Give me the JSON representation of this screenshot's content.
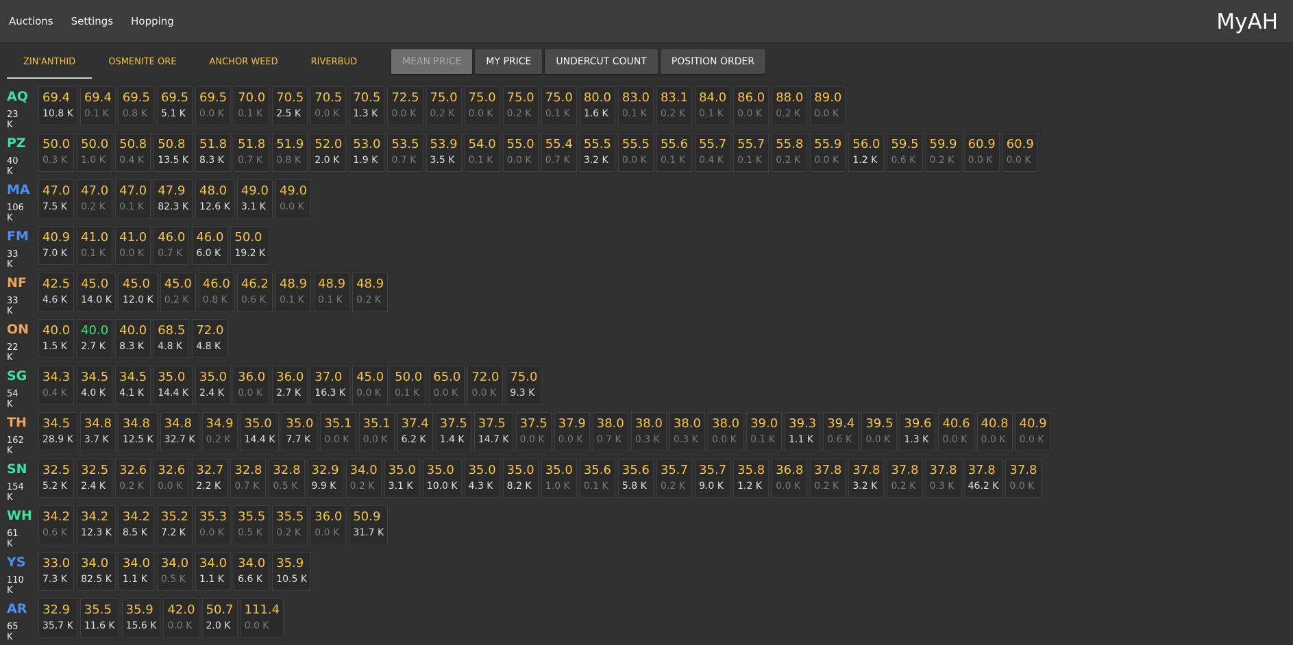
{
  "app": {
    "title": "MyAH",
    "menu": [
      "Auctions",
      "Settings",
      "Hopping"
    ]
  },
  "tabs": [
    {
      "label": "ZIN'ANTHID",
      "active": true
    },
    {
      "label": "OSMENITE ORE",
      "active": false
    },
    {
      "label": "ANCHOR WEED",
      "active": false
    },
    {
      "label": "RIVERBUD",
      "active": false
    }
  ],
  "mode_buttons": [
    {
      "label": "MEAN PRICE",
      "active": true
    },
    {
      "label": "MY PRICE",
      "active": false
    },
    {
      "label": "UNDERCUT COUNT",
      "active": false
    },
    {
      "label": "POSITION ORDER",
      "active": false
    }
  ],
  "colors": {
    "green_code": "#3fe0a0",
    "blue_code": "#4f8ff0",
    "orange_code": "#f0a25a",
    "price": "#f6c24b",
    "price_highlight": "#3fe07a"
  },
  "rows": [
    {
      "code": "AQ",
      "color": "#3fe0a0",
      "total": "23 K",
      "cells": [
        {
          "price": "69.4",
          "qty": "10.8 K",
          "dim": false
        },
        {
          "price": "69.4",
          "qty": "0.1 K",
          "dim": true
        },
        {
          "price": "69.5",
          "qty": "0.8 K",
          "dim": true
        },
        {
          "price": "69.5",
          "qty": "5.1 K",
          "dim": false
        },
        {
          "price": "69.5",
          "qty": "0.0 K",
          "dim": true
        },
        {
          "price": "70.0",
          "qty": "0.1 K",
          "dim": true
        },
        {
          "price": "70.5",
          "qty": "2.5 K",
          "dim": false
        },
        {
          "price": "70.5",
          "qty": "0.0 K",
          "dim": true
        },
        {
          "price": "70.5",
          "qty": "1.3 K",
          "dim": false
        },
        {
          "price": "72.5",
          "qty": "0.0 K",
          "dim": true
        },
        {
          "price": "75.0",
          "qty": "0.2 K",
          "dim": true
        },
        {
          "price": "75.0",
          "qty": "0.0 K",
          "dim": true
        },
        {
          "price": "75.0",
          "qty": "0.2 K",
          "dim": true
        },
        {
          "price": "75.0",
          "qty": "0.1 K",
          "dim": true
        },
        {
          "price": "80.0",
          "qty": "1.6 K",
          "dim": false
        },
        {
          "price": "83.0",
          "qty": "0.1 K",
          "dim": true
        },
        {
          "price": "83.1",
          "qty": "0.2 K",
          "dim": true
        },
        {
          "price": "84.0",
          "qty": "0.1 K",
          "dim": true
        },
        {
          "price": "86.0",
          "qty": "0.0 K",
          "dim": true
        },
        {
          "price": "88.0",
          "qty": "0.2 K",
          "dim": true
        },
        {
          "price": "89.0",
          "qty": "0.0 K",
          "dim": true
        }
      ]
    },
    {
      "code": "PZ",
      "color": "#3fe0a0",
      "total": "40 K",
      "cells": [
        {
          "price": "50.0",
          "qty": "0.3 K",
          "dim": true
        },
        {
          "price": "50.0",
          "qty": "1.0 K",
          "dim": true
        },
        {
          "price": "50.8",
          "qty": "0.4 K",
          "dim": true
        },
        {
          "price": "50.8",
          "qty": "13.5 K",
          "dim": false
        },
        {
          "price": "51.8",
          "qty": "8.3 K",
          "dim": false
        },
        {
          "price": "51.8",
          "qty": "0.7 K",
          "dim": true
        },
        {
          "price": "51.9",
          "qty": "0.8 K",
          "dim": true
        },
        {
          "price": "52.0",
          "qty": "2.0 K",
          "dim": false
        },
        {
          "price": "53.0",
          "qty": "1.9 K",
          "dim": false
        },
        {
          "price": "53.5",
          "qty": "0.7 K",
          "dim": true
        },
        {
          "price": "53.9",
          "qty": "3.5 K",
          "dim": false
        },
        {
          "price": "54.0",
          "qty": "0.1 K",
          "dim": true
        },
        {
          "price": "55.0",
          "qty": "0.0 K",
          "dim": true
        },
        {
          "price": "55.4",
          "qty": "0.7 K",
          "dim": true
        },
        {
          "price": "55.5",
          "qty": "3.2 K",
          "dim": false
        },
        {
          "price": "55.5",
          "qty": "0.0 K",
          "dim": true
        },
        {
          "price": "55.6",
          "qty": "0.1 K",
          "dim": true
        },
        {
          "price": "55.7",
          "qty": "0.4 K",
          "dim": true
        },
        {
          "price": "55.7",
          "qty": "0.1 K",
          "dim": true
        },
        {
          "price": "55.8",
          "qty": "0.2 K",
          "dim": true
        },
        {
          "price": "55.9",
          "qty": "0.0 K",
          "dim": true
        },
        {
          "price": "56.0",
          "qty": "1.2 K",
          "dim": false
        },
        {
          "price": "59.5",
          "qty": "0.6 K",
          "dim": true
        },
        {
          "price": "59.9",
          "qty": "0.2 K",
          "dim": true
        },
        {
          "price": "60.9",
          "qty": "0.0 K",
          "dim": true
        },
        {
          "price": "60.9",
          "qty": "0.0 K",
          "dim": true
        }
      ]
    },
    {
      "code": "MA",
      "color": "#4f8ff0",
      "total": "106 K",
      "cells": [
        {
          "price": "47.0",
          "qty": "7.5 K",
          "dim": false
        },
        {
          "price": "47.0",
          "qty": "0.2 K",
          "dim": true
        },
        {
          "price": "47.0",
          "qty": "0.1 K",
          "dim": true
        },
        {
          "price": "47.9",
          "qty": "82.3 K",
          "dim": false
        },
        {
          "price": "48.0",
          "qty": "12.6 K",
          "dim": false
        },
        {
          "price": "49.0",
          "qty": "3.1 K",
          "dim": false
        },
        {
          "price": "49.0",
          "qty": "0.0 K",
          "dim": true
        }
      ]
    },
    {
      "code": "FM",
      "color": "#4f8ff0",
      "total": "33 K",
      "cells": [
        {
          "price": "40.9",
          "qty": "7.0 K",
          "dim": false
        },
        {
          "price": "41.0",
          "qty": "0.1 K",
          "dim": true
        },
        {
          "price": "41.0",
          "qty": "0.0 K",
          "dim": true
        },
        {
          "price": "46.0",
          "qty": "0.7 K",
          "dim": true
        },
        {
          "price": "46.0",
          "qty": "6.0 K",
          "dim": false
        },
        {
          "price": "50.0",
          "qty": "19.2 K",
          "dim": false
        }
      ]
    },
    {
      "code": "NF",
      "color": "#f0a25a",
      "total": "33 K",
      "cells": [
        {
          "price": "42.5",
          "qty": "4.6 K",
          "dim": false
        },
        {
          "price": "45.0",
          "qty": "14.0 K",
          "dim": false
        },
        {
          "price": "45.0",
          "qty": "12.0 K",
          "dim": false
        },
        {
          "price": "45.0",
          "qty": "0.2 K",
          "dim": true
        },
        {
          "price": "46.0",
          "qty": "0.8 K",
          "dim": true
        },
        {
          "price": "46.2",
          "qty": "0.6 K",
          "dim": true
        },
        {
          "price": "48.9",
          "qty": "0.1 K",
          "dim": true
        },
        {
          "price": "48.9",
          "qty": "0.1 K",
          "dim": true
        },
        {
          "price": "48.9",
          "qty": "0.2 K",
          "dim": true
        }
      ]
    },
    {
      "code": "ON",
      "color": "#f0a25a",
      "total": "22 K",
      "cells": [
        {
          "price": "40.0",
          "qty": "1.5 K",
          "dim": false
        },
        {
          "price": "40.0",
          "qty": "2.7 K",
          "dim": false,
          "highlight": true
        },
        {
          "price": "40.0",
          "qty": "8.3 K",
          "dim": false
        },
        {
          "price": "68.5",
          "qty": "4.8 K",
          "dim": false
        },
        {
          "price": "72.0",
          "qty": "4.8 K",
          "dim": false
        }
      ]
    },
    {
      "code": "SG",
      "color": "#3fe0a0",
      "total": "54 K",
      "cells": [
        {
          "price": "34.3",
          "qty": "0.4 K",
          "dim": true
        },
        {
          "price": "34.5",
          "qty": "4.0 K",
          "dim": false
        },
        {
          "price": "34.5",
          "qty": "4.1 K",
          "dim": false
        },
        {
          "price": "35.0",
          "qty": "14.4 K",
          "dim": false
        },
        {
          "price": "35.0",
          "qty": "2.4 K",
          "dim": false
        },
        {
          "price": "36.0",
          "qty": "0.0 K",
          "dim": true
        },
        {
          "price": "36.0",
          "qty": "2.7 K",
          "dim": false
        },
        {
          "price": "37.0",
          "qty": "16.3 K",
          "dim": false
        },
        {
          "price": "45.0",
          "qty": "0.0 K",
          "dim": true
        },
        {
          "price": "50.0",
          "qty": "0.1 K",
          "dim": true
        },
        {
          "price": "65.0",
          "qty": "0.0 K",
          "dim": true
        },
        {
          "price": "72.0",
          "qty": "0.0 K",
          "dim": true
        },
        {
          "price": "75.0",
          "qty": "9.3 K",
          "dim": false
        }
      ]
    },
    {
      "code": "TH",
      "color": "#f0a25a",
      "total": "162 K",
      "cells": [
        {
          "price": "34.5",
          "qty": "28.9 K",
          "dim": false
        },
        {
          "price": "34.8",
          "qty": "3.7 K",
          "dim": false
        },
        {
          "price": "34.8",
          "qty": "12.5 K",
          "dim": false
        },
        {
          "price": "34.8",
          "qty": "32.7 K",
          "dim": false
        },
        {
          "price": "34.9",
          "qty": "0.2 K",
          "dim": true
        },
        {
          "price": "35.0",
          "qty": "14.4 K",
          "dim": false
        },
        {
          "price": "35.0",
          "qty": "7.7 K",
          "dim": false
        },
        {
          "price": "35.1",
          "qty": "0.0 K",
          "dim": true
        },
        {
          "price": "35.1",
          "qty": "0.0 K",
          "dim": true
        },
        {
          "price": "37.4",
          "qty": "6.2 K",
          "dim": false
        },
        {
          "price": "37.5",
          "qty": "1.4 K",
          "dim": false
        },
        {
          "price": "37.5",
          "qty": "14.7 K",
          "dim": false
        },
        {
          "price": "37.5",
          "qty": "0.0 K",
          "dim": true
        },
        {
          "price": "37.9",
          "qty": "0.0 K",
          "dim": true
        },
        {
          "price": "38.0",
          "qty": "0.7 K",
          "dim": true
        },
        {
          "price": "38.0",
          "qty": "0.3 K",
          "dim": true
        },
        {
          "price": "38.0",
          "qty": "0.3 K",
          "dim": true
        },
        {
          "price": "38.0",
          "qty": "0.0 K",
          "dim": true
        },
        {
          "price": "39.0",
          "qty": "0.1 K",
          "dim": true
        },
        {
          "price": "39.3",
          "qty": "1.1 K",
          "dim": false
        },
        {
          "price": "39.4",
          "qty": "0.6 K",
          "dim": true
        },
        {
          "price": "39.5",
          "qty": "0.0 K",
          "dim": true
        },
        {
          "price": "39.6",
          "qty": "1.3 K",
          "dim": false
        },
        {
          "price": "40.6",
          "qty": "0.0 K",
          "dim": true
        },
        {
          "price": "40.8",
          "qty": "0.0 K",
          "dim": true
        },
        {
          "price": "40.9",
          "qty": "0.0 K",
          "dim": true
        }
      ]
    },
    {
      "code": "SN",
      "color": "#3fe0a0",
      "total": "154 K",
      "cells": [
        {
          "price": "32.5",
          "qty": "5.2 K",
          "dim": false
        },
        {
          "price": "32.5",
          "qty": "2.4 K",
          "dim": false
        },
        {
          "price": "32.6",
          "qty": "0.2 K",
          "dim": true
        },
        {
          "price": "32.6",
          "qty": "0.0 K",
          "dim": true
        },
        {
          "price": "32.7",
          "qty": "2.2 K",
          "dim": false
        },
        {
          "price": "32.8",
          "qty": "0.7 K",
          "dim": true
        },
        {
          "price": "32.8",
          "qty": "0.5 K",
          "dim": true
        },
        {
          "price": "32.9",
          "qty": "9.9 K",
          "dim": false
        },
        {
          "price": "34.0",
          "qty": "0.2 K",
          "dim": true
        },
        {
          "price": "35.0",
          "qty": "3.1 K",
          "dim": false
        },
        {
          "price": "35.0",
          "qty": "10.0 K",
          "dim": false
        },
        {
          "price": "35.0",
          "qty": "4.3 K",
          "dim": false
        },
        {
          "price": "35.0",
          "qty": "8.2 K",
          "dim": false
        },
        {
          "price": "35.0",
          "qty": "1.0 K",
          "dim": true
        },
        {
          "price": "35.6",
          "qty": "0.1 K",
          "dim": true
        },
        {
          "price": "35.6",
          "qty": "5.8 K",
          "dim": false
        },
        {
          "price": "35.7",
          "qty": "0.2 K",
          "dim": true
        },
        {
          "price": "35.7",
          "qty": "9.0 K",
          "dim": false
        },
        {
          "price": "35.8",
          "qty": "1.2 K",
          "dim": false
        },
        {
          "price": "36.8",
          "qty": "0.0 K",
          "dim": true
        },
        {
          "price": "37.8",
          "qty": "0.2 K",
          "dim": true
        },
        {
          "price": "37.8",
          "qty": "3.2 K",
          "dim": false
        },
        {
          "price": "37.8",
          "qty": "0.2 K",
          "dim": true
        },
        {
          "price": "37.8",
          "qty": "0.3 K",
          "dim": true
        },
        {
          "price": "37.8",
          "qty": "46.2 K",
          "dim": false
        },
        {
          "price": "37.8",
          "qty": "0.0 K",
          "dim": true
        }
      ]
    },
    {
      "code": "WH",
      "color": "#3fe0a0",
      "total": "61 K",
      "cells": [
        {
          "price": "34.2",
          "qty": "0.6 K",
          "dim": true
        },
        {
          "price": "34.2",
          "qty": "12.3 K",
          "dim": false
        },
        {
          "price": "34.2",
          "qty": "8.5 K",
          "dim": false
        },
        {
          "price": "35.2",
          "qty": "7.2 K",
          "dim": false
        },
        {
          "price": "35.3",
          "qty": "0.0 K",
          "dim": true
        },
        {
          "price": "35.5",
          "qty": "0.5 K",
          "dim": true
        },
        {
          "price": "35.5",
          "qty": "0.2 K",
          "dim": true
        },
        {
          "price": "36.0",
          "qty": "0.0 K",
          "dim": true
        },
        {
          "price": "50.9",
          "qty": "31.7 K",
          "dim": false
        }
      ]
    },
    {
      "code": "YS",
      "color": "#4f8ff0",
      "total": "110 K",
      "cells": [
        {
          "price": "33.0",
          "qty": "7.3 K",
          "dim": false
        },
        {
          "price": "34.0",
          "qty": "82.5 K",
          "dim": false
        },
        {
          "price": "34.0",
          "qty": "1.1 K",
          "dim": false
        },
        {
          "price": "34.0",
          "qty": "0.5 K",
          "dim": true
        },
        {
          "price": "34.0",
          "qty": "1.1 K",
          "dim": false
        },
        {
          "price": "34.0",
          "qty": "6.6 K",
          "dim": false
        },
        {
          "price": "35.9",
          "qty": "10.5 K",
          "dim": false
        }
      ]
    },
    {
      "code": "AR",
      "color": "#4f8ff0",
      "total": "65 K",
      "cells": [
        {
          "price": "32.9",
          "qty": "35.7 K",
          "dim": false
        },
        {
          "price": "35.5",
          "qty": "11.6 K",
          "dim": false
        },
        {
          "price": "35.9",
          "qty": "15.6 K",
          "dim": false
        },
        {
          "price": "42.0",
          "qty": "0.0 K",
          "dim": true
        },
        {
          "price": "50.7",
          "qty": "2.0 K",
          "dim": false
        },
        {
          "price": "111.4",
          "qty": "0.0 K",
          "dim": true
        }
      ]
    }
  ]
}
